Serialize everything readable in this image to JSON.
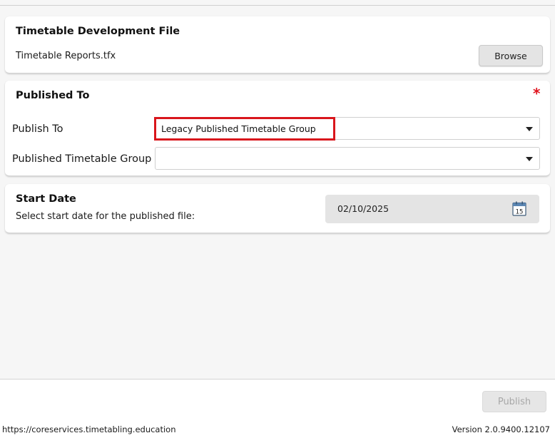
{
  "development_file": {
    "title": "Timetable Development File",
    "file_name": "Timetable Reports.tfx",
    "browse_label": "Browse"
  },
  "published_to": {
    "title": "Published To",
    "required_marker": "*",
    "publish_to": {
      "label": "Publish To",
      "value": "Legacy Published Timetable Group"
    },
    "published_group": {
      "label": "Published Timetable Group",
      "value": ""
    }
  },
  "start_date": {
    "title": "Start Date",
    "subtitle": "Select start date for the published file:",
    "value": "02/10/2025",
    "calendar_icon_day": "15"
  },
  "footer": {
    "publish_label": "Publish",
    "url": "https://coreservices.timetabling.education",
    "version": "Version 2.0.9400.12107"
  },
  "colors": {
    "highlight": "#d9161c",
    "required": "#e0141e"
  },
  "icons": [
    "chevron-down-icon",
    "calendar-icon"
  ]
}
